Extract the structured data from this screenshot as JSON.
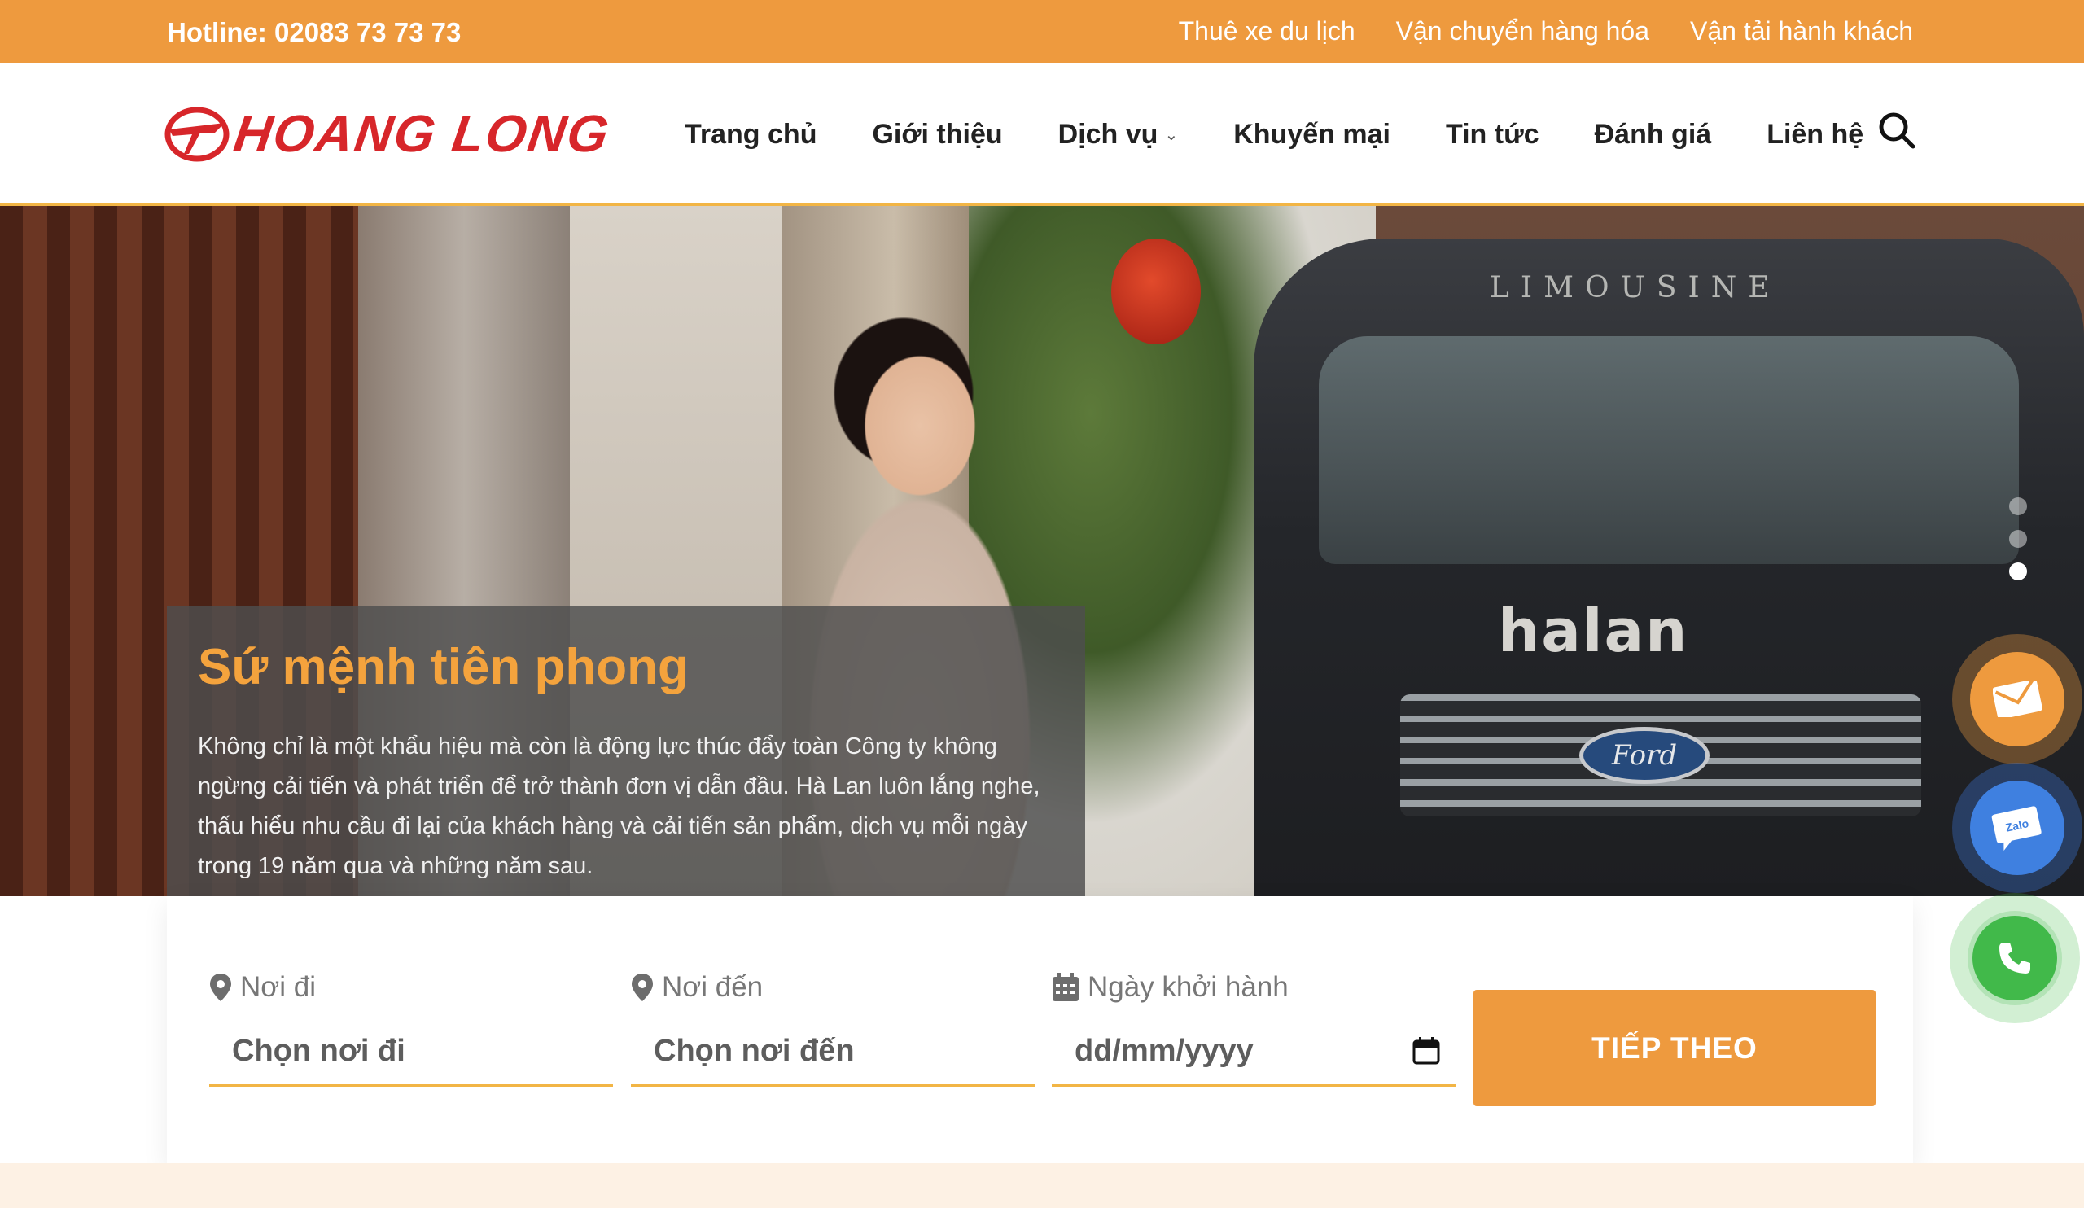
{
  "topbar": {
    "hotline": "Hotline: 02083 73 73 73",
    "links": [
      "Thuê xe du lịch",
      "Vận chuyển hàng hóa",
      "Vận tải hành khách"
    ]
  },
  "header": {
    "logo_text": "HOANG LONG",
    "nav": {
      "home": "Trang chủ",
      "about": "Giới thiệu",
      "services": "Dịch vụ",
      "promotions": "Khuyến mại",
      "news": "Tin tức",
      "reviews": "Đánh giá",
      "contact": "Liên hệ"
    }
  },
  "hero": {
    "van_label": "LIMOUSINE",
    "van_brand": "halan",
    "van_badge": "Ford",
    "caption_title": "Sứ mệnh tiên phong",
    "caption_text": "Không chỉ là một khẩu hiệu mà còn là động lực thúc đẩy toàn Công ty không ngừng cải tiến và phát triển để trở thành đơn vị dẫn đầu. Hà Lan luôn lắng nghe, thấu hiểu nhu cầu đi lại của khách hàng và cải tiến sản phẩm, dịch vụ mỗi ngày trong 19 năm qua và những năm sau.",
    "slides": 3,
    "active_slide": 3
  },
  "booking": {
    "from_label": "Nơi đi",
    "from_value": "Chọn nơi đi",
    "to_label": "Nơi đến",
    "to_value": "Chọn nơi đến",
    "date_label": "Ngày khởi hành",
    "date_value": "dd/mm/yyyy",
    "next_button": "TIẾP THEO"
  },
  "floating": {
    "mail": "mail-icon",
    "zalo_label": "Zalo",
    "phone": "phone-icon"
  },
  "colors": {
    "accent": "#ee9a3e",
    "brand_red": "#d7262a",
    "caption_title": "#f4a33d"
  }
}
